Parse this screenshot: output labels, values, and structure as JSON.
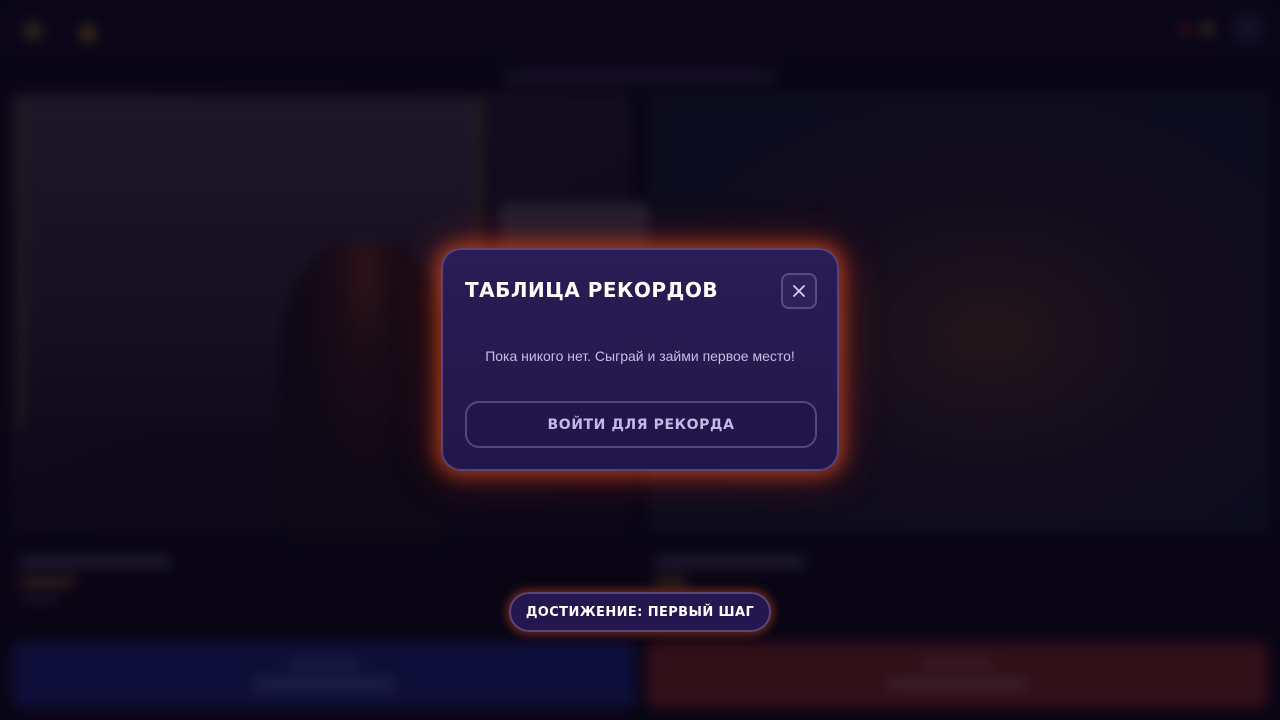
{
  "modal": {
    "title": "ТАБЛИЦА РЕКОРДОВ",
    "close_icon": "close-icon",
    "message": "Пока никого нет. Сыграй и займи первое место!",
    "login_button_label": "ВОЙТИ ДЛЯ РЕКОРДА"
  },
  "toast": {
    "text": "ДОСТИЖЕНИЕ: ПЕРВЫЙ ШАГ"
  },
  "colors": {
    "modal_background": "#2a1c55",
    "modal_glow": "#ff5a1e",
    "left_choice_button": "#1a1f6e",
    "right_choice_button": "#6e2020"
  }
}
